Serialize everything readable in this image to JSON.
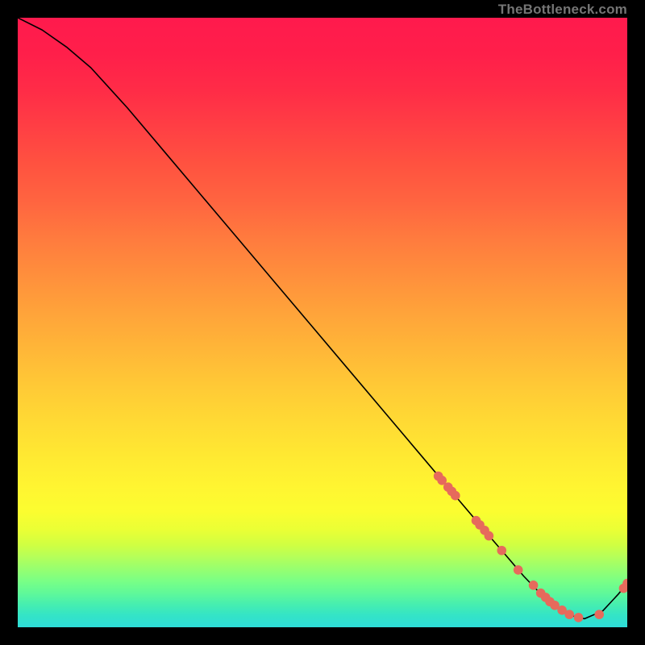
{
  "attribution": "TheBottleneck.com",
  "chart_data": {
    "type": "line",
    "title": "",
    "xlabel": "",
    "ylabel": "",
    "xlim": [
      0,
      100
    ],
    "ylim": [
      0,
      100
    ],
    "grid": false,
    "note": "No numeric axis ticks are displayed; values are in arbitrary 0–100 units matching the plot area.",
    "series": [
      {
        "name": "curve",
        "color": "#000000",
        "x": [
          0,
          4,
          8,
          12,
          18,
          24,
          30,
          36,
          42,
          48,
          54,
          60,
          66,
          72,
          77,
          80,
          83,
          85.5,
          88,
          90.5,
          93,
          96,
          98.5,
          100
        ],
        "y": [
          100,
          98,
          95.2,
          91.8,
          85.2,
          78.1,
          71.0,
          63.9,
          56.8,
          49.7,
          42.6,
          35.5,
          28.4,
          21.3,
          15.4,
          11.9,
          8.4,
          5.8,
          3.6,
          2.0,
          1.4,
          2.7,
          5.4,
          7.2
        ]
      }
    ],
    "scatter_sets": [
      {
        "name": "dots-descending",
        "color": "#e66a5c",
        "radius": 5.8,
        "x": [
          69.0,
          69.6,
          70.6,
          71.2,
          71.8,
          75.2,
          75.8,
          76.6,
          77.3,
          79.4
        ],
        "y": [
          24.8,
          24.1,
          23.0,
          22.3,
          21.6,
          17.5,
          16.8,
          15.9,
          15.0,
          12.6
        ]
      },
      {
        "name": "dots-valley",
        "color": "#e66a5c",
        "radius": 5.8,
        "x": [
          82.1,
          84.6,
          85.8,
          86.6,
          87.3,
          88.1,
          89.3,
          90.5,
          92.0,
          95.4
        ],
        "y": [
          9.4,
          6.9,
          5.6,
          4.9,
          4.2,
          3.6,
          2.8,
          2.1,
          1.6,
          2.1
        ]
      },
      {
        "name": "dots-rising-end",
        "color": "#e66a5c",
        "radius": 5.8,
        "x": [
          99.4,
          100.0
        ],
        "y": [
          6.4,
          7.2
        ]
      }
    ],
    "background": {
      "type": "vertical-gradient",
      "stops": [
        {
          "pos": 0.0,
          "color": "#ff1a4d"
        },
        {
          "pos": 0.4,
          "color": "#ff8e3c"
        },
        {
          "pos": 0.75,
          "color": "#fff531"
        },
        {
          "pos": 0.9,
          "color": "#96ff70"
        },
        {
          "pos": 1.0,
          "color": "#2edcd8"
        }
      ]
    }
  }
}
